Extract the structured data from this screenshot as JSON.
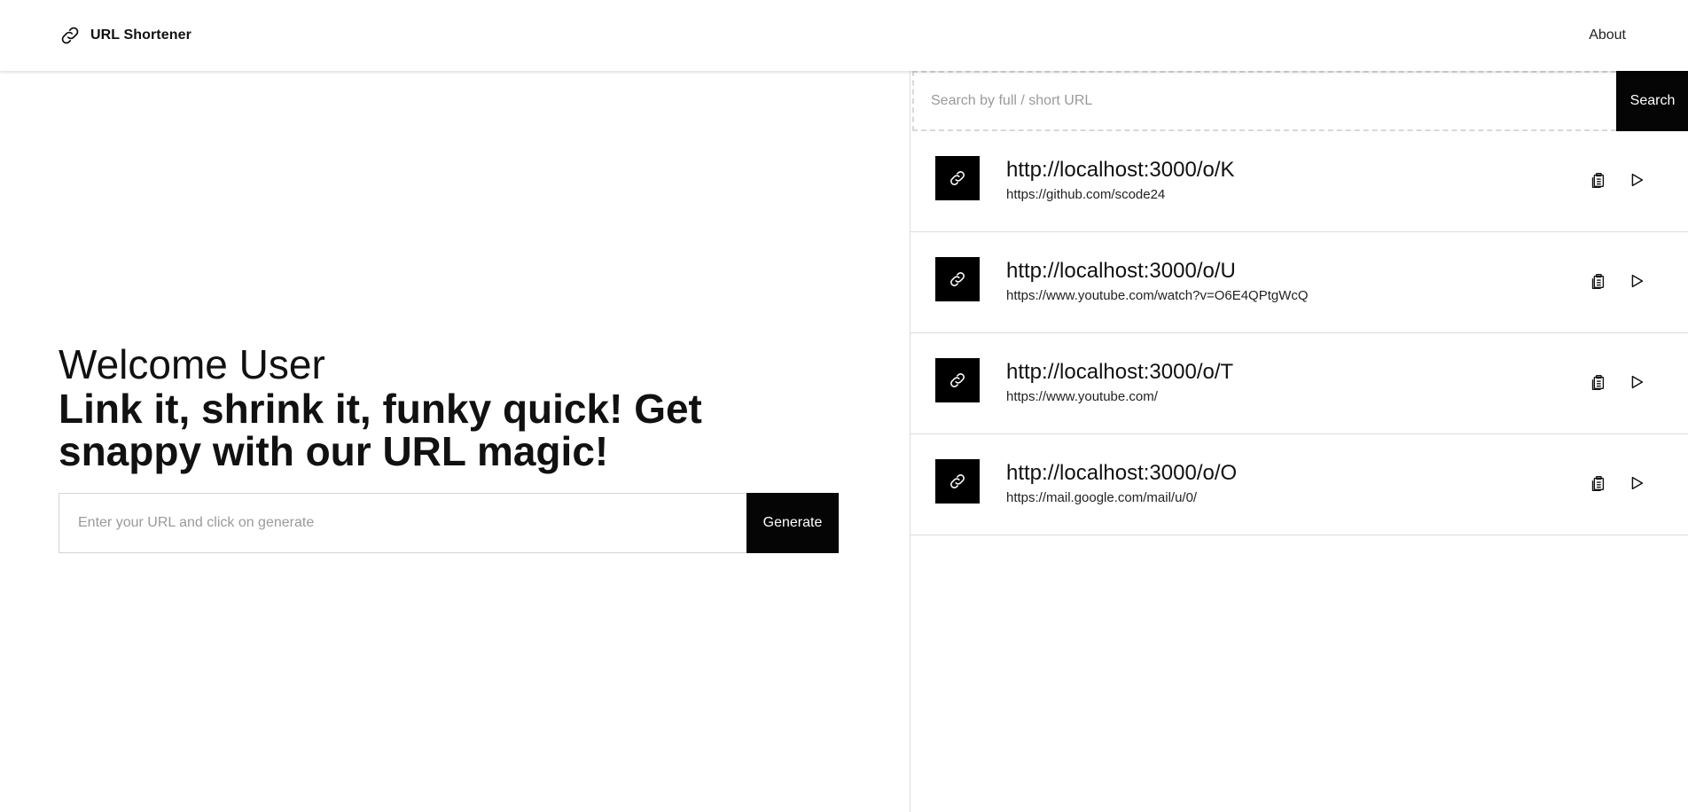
{
  "header": {
    "brand_icon": "link-icon",
    "brand_title": "URL Shortener",
    "nav_about": "About"
  },
  "hero": {
    "greeting": "Welcome User",
    "tagline": "Link it, shrink it, funky quick! Get snappy with our URL magic!",
    "url_input_value": "",
    "url_input_placeholder": "Enter your URL and click on generate",
    "generate_label": "Generate"
  },
  "search": {
    "value": "",
    "placeholder": "Search by full / short URL",
    "button_label": "Search"
  },
  "links": [
    {
      "short_url": "http://localhost:3000/o/K",
      "full_url": "https://github.com/scode24",
      "icons": [
        "link-icon",
        "clipboard-icon",
        "play-icon"
      ]
    },
    {
      "short_url": "http://localhost:3000/o/U",
      "full_url": "https://www.youtube.com/watch?v=O6E4QPtgWcQ",
      "icons": [
        "link-icon",
        "clipboard-icon",
        "play-icon"
      ]
    },
    {
      "short_url": "http://localhost:3000/o/T",
      "full_url": "https://www.youtube.com/",
      "icons": [
        "link-icon",
        "clipboard-icon",
        "play-icon"
      ]
    },
    {
      "short_url": "http://localhost:3000/o/O",
      "full_url": "https://mail.google.com/mail/u/0/",
      "icons": [
        "link-icon",
        "clipboard-icon",
        "play-icon"
      ]
    }
  ],
  "colors": {
    "accent": "#050505",
    "background": "#ffffff",
    "divider": "#dcdcdc",
    "placeholder": "#9a9a9a"
  }
}
